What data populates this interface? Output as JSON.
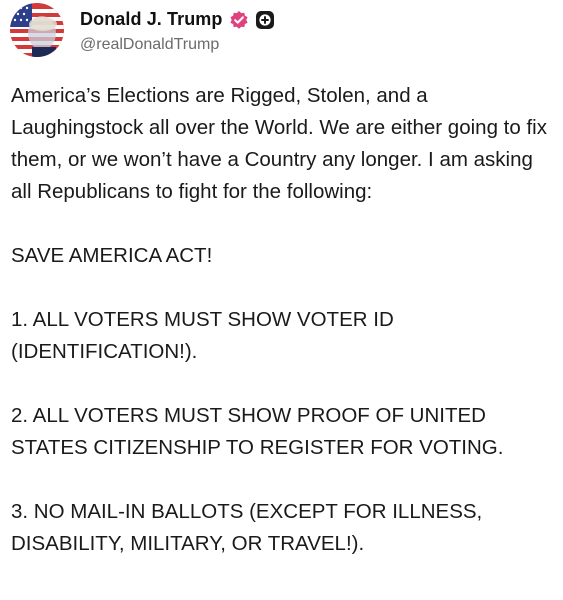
{
  "author": {
    "display_name": "Donald J. Trump",
    "handle": "@realDonaldTrump",
    "verified_color": "#e0427f",
    "badge_color": "#1a1a1a"
  },
  "post": {
    "paragraphs": [
      "America’s Elections are Rigged, Stolen, and a Laughingstock all over the World. We are either going to fix them, or we won’t have a Country any longer. I am asking all Republicans to fight for the following:",
      "SAVE AMERICA ACT!",
      "1. ALL VOTERS MUST SHOW VOTER ID (IDENTIFICATION!).",
      "2. ALL VOTERS MUST SHOW PROOF OF UNITED STATES CITIZENSHIP TO REGISTER FOR VOTING.",
      "3. NO MAIL-IN BALLOTS (EXCEPT FOR ILLNESS, DISABILITY, MILITARY, OR TRAVEL!)."
    ]
  }
}
